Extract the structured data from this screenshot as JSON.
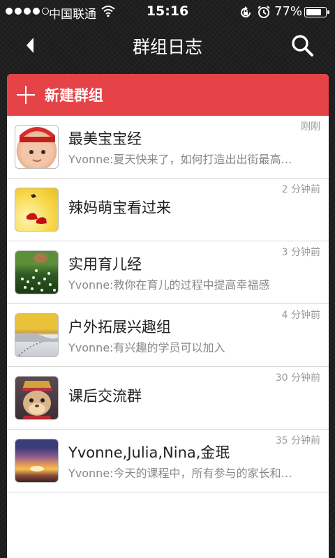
{
  "status_bar": {
    "carrier": "中国联通",
    "time": "15:16",
    "battery": "77%",
    "battery_level": 0.77
  },
  "nav": {
    "title": "群组日志"
  },
  "new_group": {
    "label": "新建群组"
  },
  "groups": [
    {
      "name": "最美宝宝经",
      "preview": "Yvonne:夏天快来了，如何打造出出街最高…",
      "time": "刚刚"
    },
    {
      "name": "辣妈萌宝看过来",
      "preview": "",
      "time": "2 分钟前"
    },
    {
      "name": "实用育儿经",
      "preview": "Yvonne:教你在育儿的过程中提高幸福感",
      "time": "3 分钟前"
    },
    {
      "name": "户外拓展兴趣组",
      "preview": "Yvonne:有兴趣的学员可以加入",
      "time": "4 分钟前"
    },
    {
      "name": "课后交流群",
      "preview": "",
      "time": "30 分钟前"
    },
    {
      "name": "Yvonne,Julia,Nina,金珉",
      "preview": "Yvonne:今天的课程中，所有参与的家长和…",
      "time": "35 分钟前"
    }
  ]
}
